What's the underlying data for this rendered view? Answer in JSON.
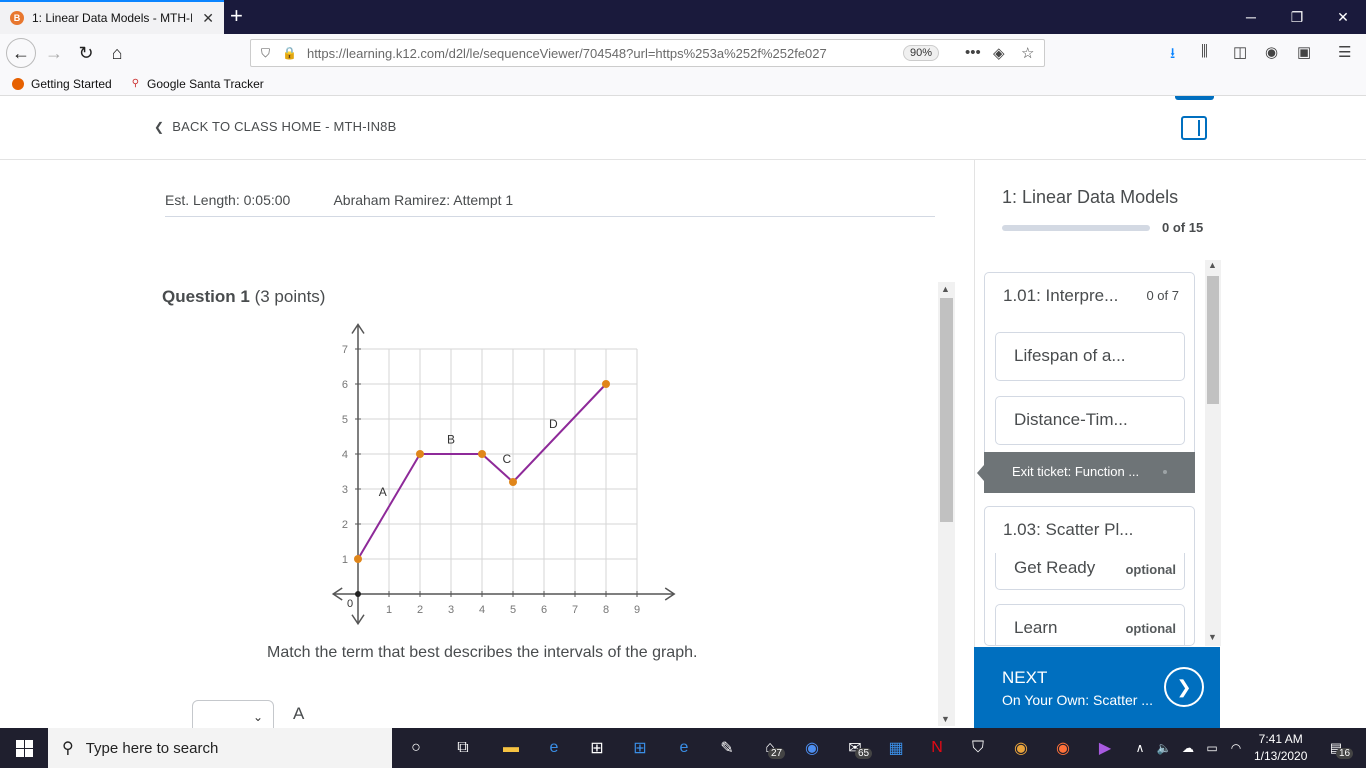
{
  "browser": {
    "tab_title": "1: Linear Data Models - MTH-IN8B",
    "favicon_letter": "B",
    "url": "https://learning.k12.com/d2l/le/sequenceViewer/704548?url=https%253a%252f%252fe027",
    "zoom": "90%",
    "bookmarks": [
      "Getting Started",
      "Google Santa Tracker"
    ]
  },
  "page": {
    "back_link": "BACK TO CLASS HOME - MTH-IN8B",
    "est_length": "Est. Length: 0:05:00",
    "attempt": "Abraham Ramirez: Attempt 1",
    "question_title": "Question 1",
    "question_points": "(3 points)",
    "prompt": "Match the term that best describes the intervals of the graph.",
    "answer_label": "A"
  },
  "chart_data": {
    "type": "line",
    "x_ticks": [
      "1",
      "2",
      "3",
      "4",
      "5",
      "6",
      "7",
      "8",
      "9"
    ],
    "y_ticks": [
      "1",
      "2",
      "3",
      "4",
      "5",
      "6",
      "7"
    ],
    "origin_label": "0",
    "xlim": [
      0,
      9
    ],
    "ylim": [
      0,
      7
    ],
    "grid": true,
    "points": [
      {
        "x": 0,
        "y": 1
      },
      {
        "x": 2,
        "y": 4
      },
      {
        "x": 4,
        "y": 4
      },
      {
        "x": 5,
        "y": 3.2
      },
      {
        "x": 8,
        "y": 6
      }
    ],
    "segment_labels": [
      {
        "label": "A",
        "x": 0.8,
        "y": 2.8
      },
      {
        "label": "B",
        "x": 3,
        "y": 4.3
      },
      {
        "label": "C",
        "x": 4.8,
        "y": 3.75
      },
      {
        "label": "D",
        "x": 6.3,
        "y": 4.75
      }
    ],
    "line_color": "#8e2a99",
    "point_color": "#e0861a"
  },
  "sidebar": {
    "title": "1: Linear Data Models",
    "progress": "0 of 15",
    "progress_fraction": 0,
    "modules": [
      {
        "title": "1.01: Interpre...",
        "count": "0 of 7",
        "items": [
          {
            "label": "Lifespan of a..."
          },
          {
            "label": "Distance-Tim..."
          }
        ],
        "active_item": "Exit ticket: Function ..."
      },
      {
        "title": "1.03: Scatter Pl...",
        "items": [
          {
            "label": "Get Ready",
            "optional": "optional"
          },
          {
            "label": "Learn",
            "optional": "optional"
          }
        ]
      }
    ],
    "next_label": "NEXT",
    "next_sub": "On Your Own: Scatter ..."
  },
  "taskbar": {
    "search_placeholder": "Type here to search",
    "badges": [
      "27",
      "65"
    ],
    "time": "7:41 AM",
    "date": "1/13/2020",
    "notifications": "16"
  },
  "colors": {
    "accent": "#006fbf",
    "tabbar": "#1a1a3c",
    "taskbar": "#1f1f2e"
  }
}
